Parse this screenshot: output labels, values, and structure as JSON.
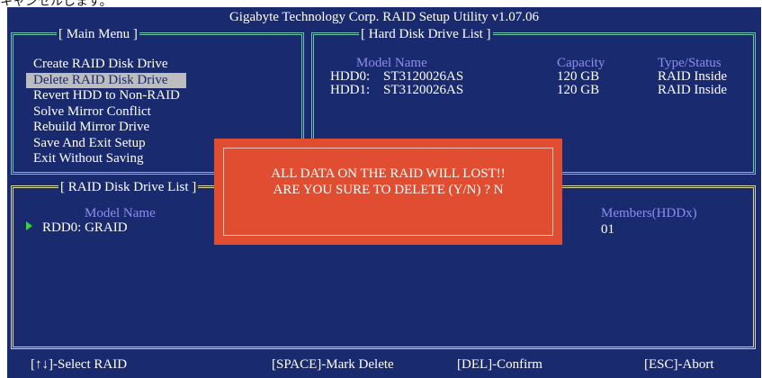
{
  "page_caption": "キャンセルします。",
  "app": {
    "title": "Gigabyte Technology Corp.  RAID Setup Utility  v1.07.06"
  },
  "main_menu": {
    "title": "[ Main Menu ]",
    "items": [
      "Create RAID Disk Drive",
      "Delete RAID Disk Drive",
      "Revert HDD to Non-RAID",
      "Solve Mirror Conflict",
      "Rebuild Mirror Drive",
      "Save And Exit Setup",
      "Exit Without Saving"
    ],
    "selected_index": 1
  },
  "hdd_list": {
    "title": "[ Hard Disk Drive List ]",
    "headers": {
      "model": "Model Name",
      "capacity": "Capacity",
      "type": "Type/Status"
    },
    "rows": [
      {
        "label": "HDD0:",
        "model": "ST3120026AS",
        "capacity": "120 GB",
        "type": "RAID Inside"
      },
      {
        "label": "HDD1:",
        "model": "ST3120026AS",
        "capacity": "120 GB",
        "type": "RAID Inside"
      }
    ]
  },
  "raid_list": {
    "title": "[ RAID Disk Drive List ]",
    "headers": {
      "model": "Model Name",
      "members": "Members(HDDx)"
    },
    "rows": [
      {
        "name": "RDD0: GRAID",
        "members": "01"
      }
    ]
  },
  "dialog": {
    "line1": "ALL DATA ON THE RAID WILL LOST!!",
    "line2": "ARE YOU SURE TO DELETE (Y/N) ? N"
  },
  "footer": {
    "select": "[↑↓]-Select RAID",
    "mark": "[SPACE]-Mark Delete",
    "confirm": "[DEL]-Confirm",
    "abort": "[ESC]-Abort"
  },
  "colors": {
    "background": "#1a2a6e",
    "frame_green": "#6ec2ae",
    "frame_yellow": "#dcd8a4",
    "header_text": "#8d8df0",
    "dialog": "#e04d30",
    "selection": "#bdbdbd",
    "arrow": "#35d635"
  }
}
